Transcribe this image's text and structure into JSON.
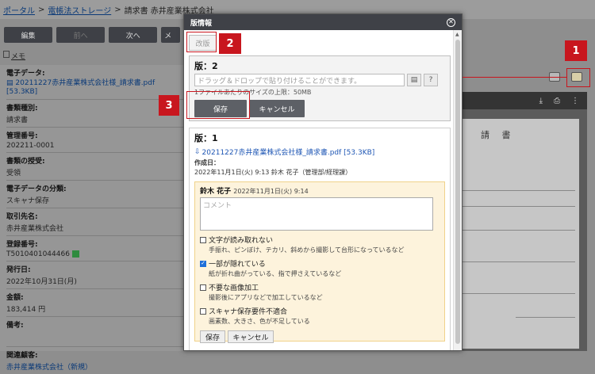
{
  "breadcrumb": {
    "portal": "ポータル",
    "sep1": ">",
    "storage": "電帳法ストレージ",
    "sep2": ">",
    "current": "請求書 赤井産業株式会社"
  },
  "toolbar": {
    "edit": "編集",
    "prev": "前へ",
    "next": "次へ",
    "more": "メ"
  },
  "memo": {
    "label": "メモ"
  },
  "fields": [
    {
      "label": "電子データ:",
      "value": "20211227赤井産業株式会社様_請求書.pdf [53.3KB]",
      "link": true
    },
    {
      "label": "書類種別:",
      "value": "請求書"
    },
    {
      "label": "管理番号:",
      "value": "202211-0001"
    },
    {
      "label": "書類の授受:",
      "value": "受領"
    },
    {
      "label": "電子データの分類:",
      "value": "スキャナ保存"
    },
    {
      "label": "取引先名:",
      "value": "赤井産業株式会社"
    },
    {
      "label": "登録番号:",
      "value": "T5010401044466"
    },
    {
      "label": "発行日:",
      "value": "2022年10月31日(月)"
    },
    {
      "label": "金額:",
      "value": "183,414 円"
    },
    {
      "label": "備考:",
      "value": ""
    },
    {
      "label": "関連顧客:",
      "value": "赤井産業株式会社（新規）",
      "link": true
    }
  ],
  "doc_preview": {
    "title": "請 書"
  },
  "callouts": {
    "c1": "1",
    "c2": "2",
    "c3": "3"
  },
  "dialog": {
    "title": "版情報",
    "close_icon": "close-icon",
    "kaihan_label": "改版",
    "new_version": {
      "title": "版：2",
      "drop_placeholder": "ドラッグ＆ドロップで貼り付けることができます。",
      "limit": "1ファイルあたりのサイズの上限：50MB",
      "save_label": "保存",
      "cancel_label": "キャンセル"
    },
    "version1": {
      "title": "版：1",
      "file": "20211227赤井産業株式会社様_請求書.pdf [53.3KB]",
      "created_label": "作成日：",
      "created_value": "2022年11月1日(火) 9:13 鈴木 花子（管理部/経理課）",
      "comment": {
        "author": "鈴木 花子",
        "datetime": "2022年11月1日(火) 9:14",
        "placeholder": "コメント",
        "checks": [
          {
            "label": "文字が読み取れない",
            "desc": "手振れ、ピンぼけ、テカリ、斜めから撮影して台形になっているなど",
            "checked": false
          },
          {
            "label": "一部が隠れている",
            "desc": "紙が折れ曲がっている、指で押さえているなど",
            "checked": true
          },
          {
            "label": "不要な画像加工",
            "desc": "撮影後にアプリなどで加工しているなど",
            "checked": false
          },
          {
            "label": "スキャナ保存要件不適合",
            "desc": "画素数、大きさ、色が不足している",
            "checked": false
          }
        ],
        "save_label": "保存",
        "cancel_label": "キャンセル"
      }
    }
  }
}
